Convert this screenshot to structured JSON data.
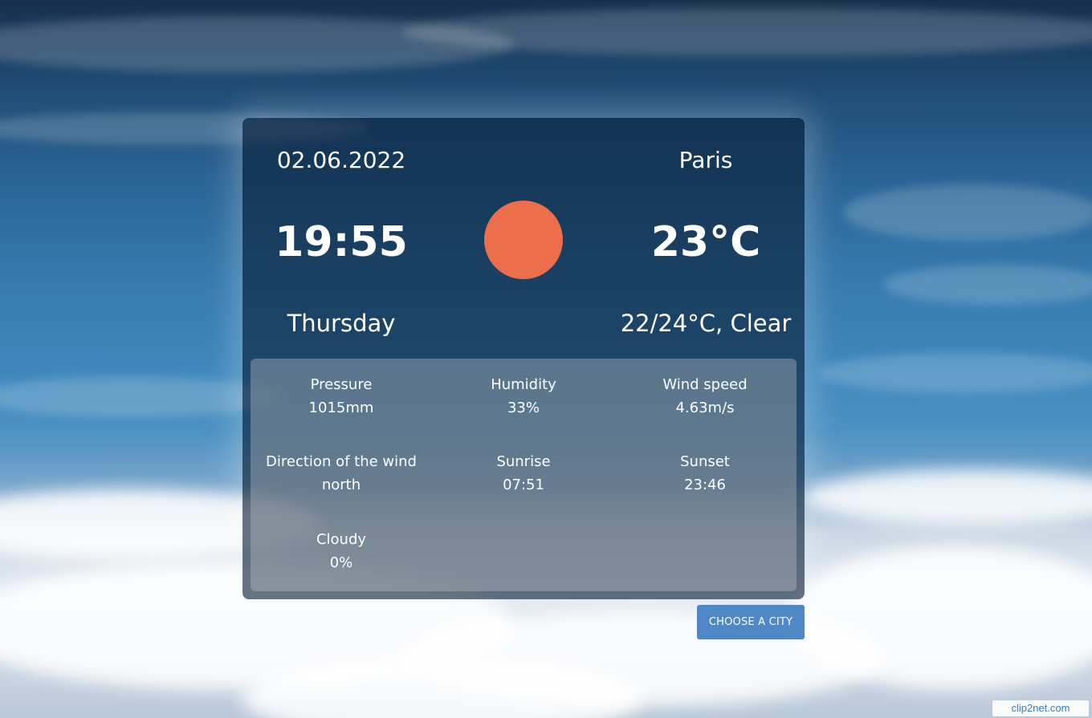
{
  "card": {
    "date": "02.06.2022",
    "city": "Paris",
    "time": "19:55",
    "temperature": "23°C",
    "day": "Thursday",
    "summary": "22/24°C, Clear",
    "sun_color": "#ec6e4b"
  },
  "details": [
    {
      "label": "Pressure",
      "value": "1015mm"
    },
    {
      "label": "Humidity",
      "value": "33%"
    },
    {
      "label": "Wind speed",
      "value": "4.63m/s"
    },
    {
      "label": "Direction of the wind",
      "value": "north"
    },
    {
      "label": "Sunrise",
      "value": "07:51"
    },
    {
      "label": "Sunset",
      "value": "23:46"
    },
    {
      "label": "Cloudy",
      "value": "0%"
    }
  ],
  "actions": {
    "choose_city_label": "CHOOSE A CITY"
  },
  "watermark": {
    "text": "clip2net.com"
  }
}
